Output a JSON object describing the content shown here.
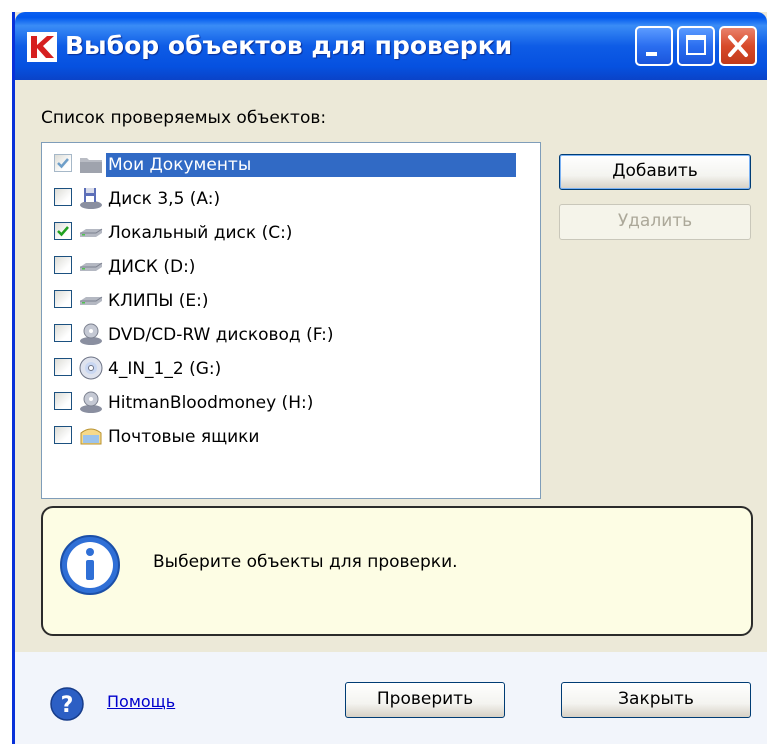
{
  "window": {
    "title": "Выбор объектов для проверки"
  },
  "list": {
    "label": "Список проверяемых объектов:",
    "items": [
      {
        "label": "Мои Документы",
        "checked": true,
        "selected": true,
        "icon": "folder-icon"
      },
      {
        "label": "Диск 3,5 (A:)",
        "checked": false,
        "selected": false,
        "icon": "floppy-drive-icon"
      },
      {
        "label": "Локальный диск (C:)",
        "checked": true,
        "selected": false,
        "icon": "hard-drive-icon"
      },
      {
        "label": "ДИСК (D:)",
        "checked": false,
        "selected": false,
        "icon": "hard-drive-icon"
      },
      {
        "label": "КЛИПЫ (E:)",
        "checked": false,
        "selected": false,
        "icon": "hard-drive-icon"
      },
      {
        "label": "DVD/CD-RW дисковод (F:)",
        "checked": false,
        "selected": false,
        "icon": "optical-drive-icon"
      },
      {
        "label": "4_IN_1_2 (G:)",
        "checked": false,
        "selected": false,
        "icon": "cd-disc-icon"
      },
      {
        "label": "HitmanBloodmoney (H:)",
        "checked": false,
        "selected": false,
        "icon": "optical-drive-icon"
      },
      {
        "label": "Почтовые ящики",
        "checked": false,
        "selected": false,
        "icon": "mailbox-icon"
      }
    ]
  },
  "buttons": {
    "add": "Добавить",
    "remove": "Удалить",
    "check": "Проверить",
    "close": "Закрыть"
  },
  "info": {
    "message": "Выберите объекты для проверки."
  },
  "footer": {
    "help": "Помощь"
  },
  "colors": {
    "titlebar": "#0a5ff0",
    "selection": "#316ac5",
    "check": "#21a121",
    "info_bg": "#fdfde4"
  }
}
